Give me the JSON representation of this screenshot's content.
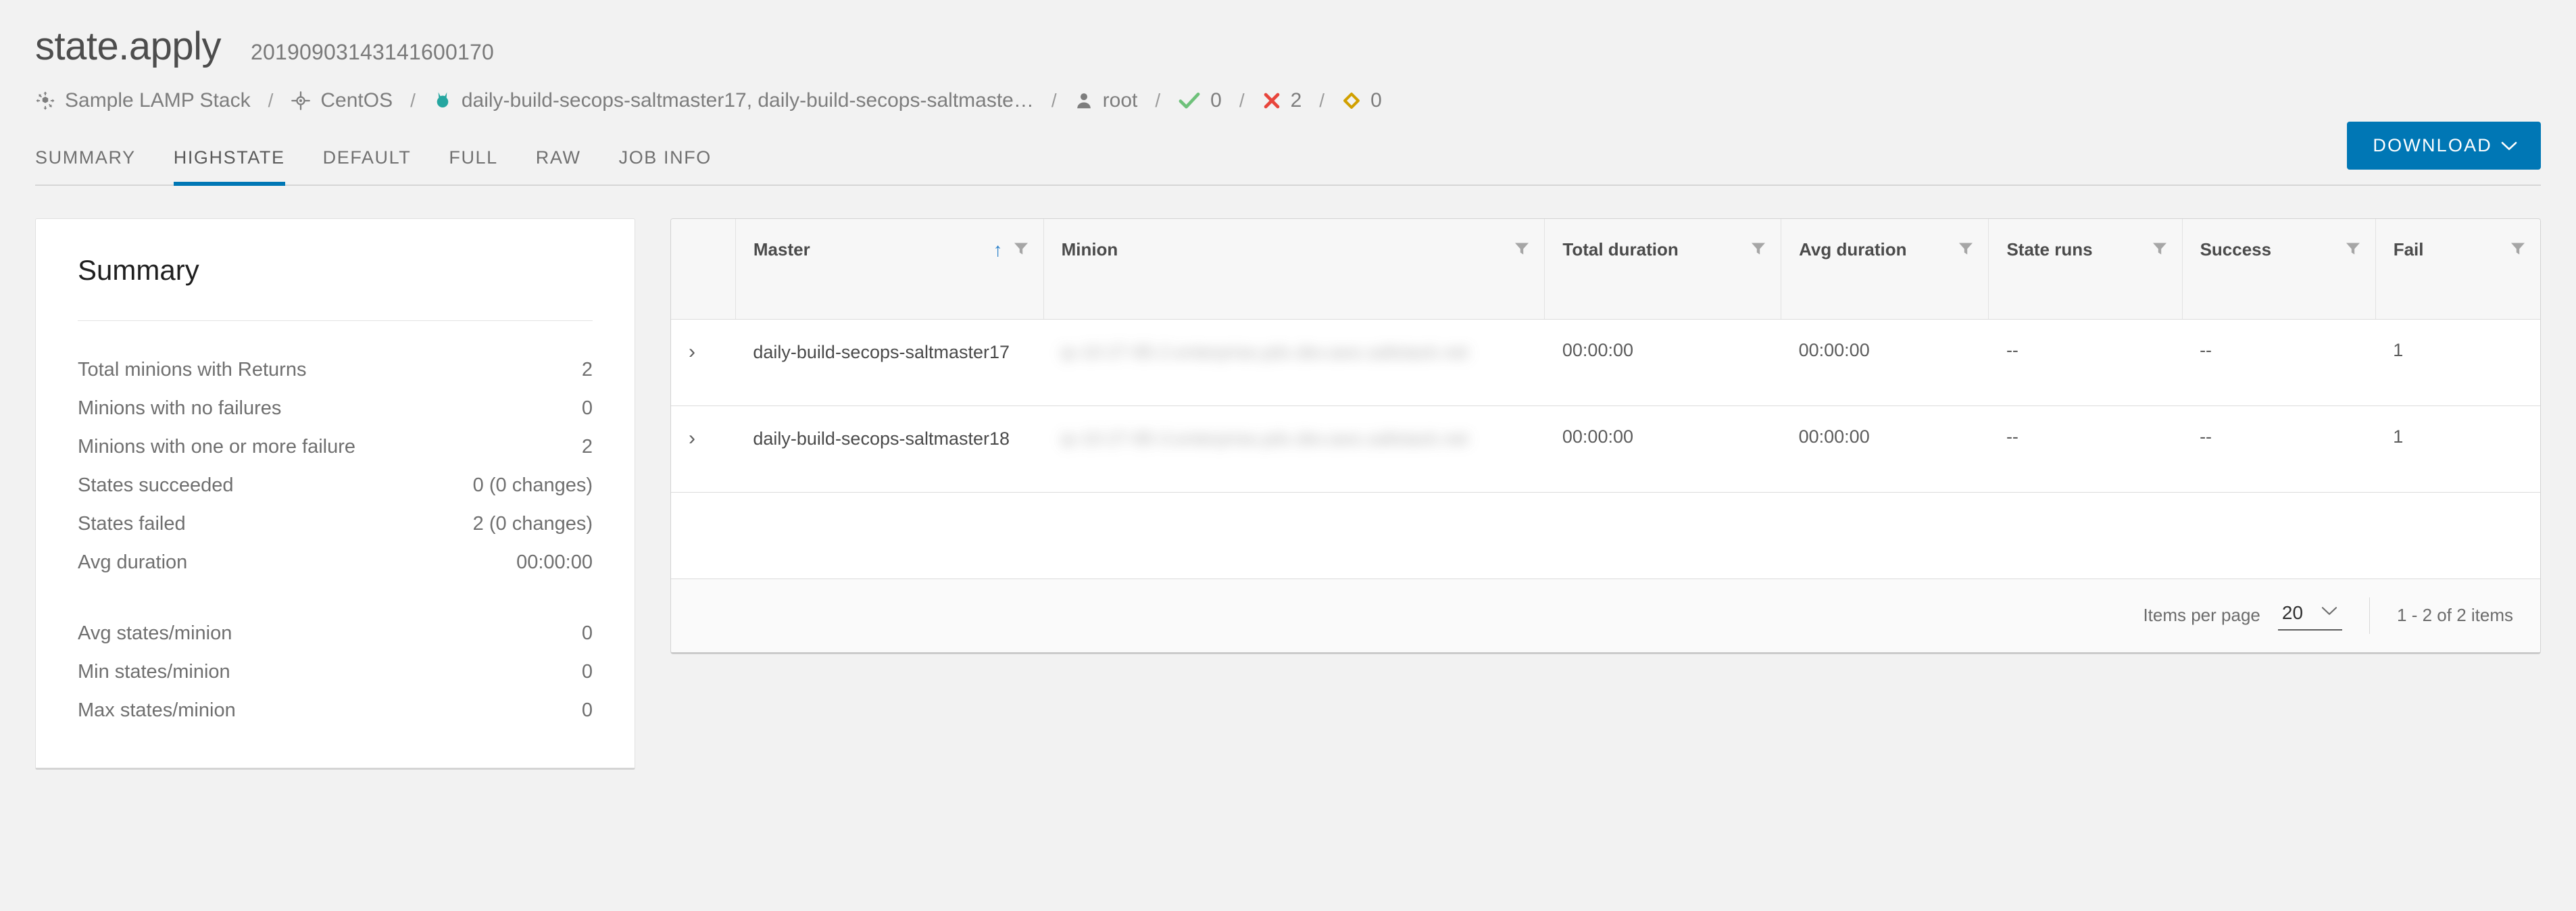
{
  "header": {
    "title": "state.apply",
    "job_id": "20190903143141600170"
  },
  "breadcrumb": {
    "items": [
      {
        "icon": "target-cluster-icon",
        "label": "Sample LAMP Stack"
      },
      {
        "icon": "crosshair-icon",
        "label": "CentOS"
      },
      {
        "icon": "salt-minion-icon",
        "label": "daily-build-secops-saltmaster17, daily-build-secops-saltmaste…"
      },
      {
        "icon": "user-icon",
        "label": "root"
      }
    ],
    "separator": "/",
    "stats": [
      {
        "icon": "check-icon",
        "value": "0",
        "color": "#6ec17a"
      },
      {
        "icon": "x-icon",
        "value": "2",
        "color": "#e8453c"
      },
      {
        "icon": "diamond-icon",
        "value": "0",
        "color": "#d1a000"
      }
    ]
  },
  "tabs": {
    "items": [
      {
        "label": "SUMMARY",
        "active": false
      },
      {
        "label": "HIGHSTATE",
        "active": true
      },
      {
        "label": "DEFAULT",
        "active": false
      },
      {
        "label": "FULL",
        "active": false
      },
      {
        "label": "RAW",
        "active": false
      },
      {
        "label": "JOB INFO",
        "active": false
      }
    ],
    "active_color": "#0077b5"
  },
  "toolbar": {
    "download_label": "DOWNLOAD",
    "download_caret": "⌄"
  },
  "summary": {
    "title": "Summary",
    "rows_group_1": [
      {
        "label": "Total minions with Returns",
        "value": "2"
      },
      {
        "label": "Minions with no failures",
        "value": "0"
      },
      {
        "label": "Minions with one or more failure",
        "value": "2"
      },
      {
        "label": "States succeeded",
        "value": "0 (0 changes)"
      },
      {
        "label": "States failed",
        "value": "2 (0 changes)"
      },
      {
        "label": "Avg duration",
        "value": "00:00:00"
      }
    ],
    "rows_group_2": [
      {
        "label": "Avg states/minion",
        "value": "0"
      },
      {
        "label": "Min states/minion",
        "value": "0"
      },
      {
        "label": "Max states/minion",
        "value": "0"
      }
    ]
  },
  "table": {
    "columns": [
      {
        "key": "expander",
        "label": "",
        "sorted": false,
        "filter": false
      },
      {
        "key": "master",
        "label": "Master",
        "sorted": true,
        "sort_dir": "↑",
        "filter": true
      },
      {
        "key": "minion",
        "label": "Minion",
        "sorted": false,
        "filter": true
      },
      {
        "key": "total_duration",
        "label": "Total duration",
        "sorted": false,
        "filter": true
      },
      {
        "key": "avg_duration",
        "label": "Avg duration",
        "sorted": false,
        "filter": true
      },
      {
        "key": "state_runs",
        "label": "State runs",
        "sorted": false,
        "filter": true
      },
      {
        "key": "success",
        "label": "Success",
        "sorted": false,
        "filter": true
      },
      {
        "key": "fail",
        "label": "Fail",
        "sorted": false,
        "filter": true
      }
    ],
    "rows": [
      {
        "expander": "›",
        "master": "daily-build-secops-saltmaster17",
        "minion": "ip-10-27-85-2.enterprise.pdx.dev.aws.saltstack.net",
        "total_duration": "00:00:00",
        "avg_duration": "00:00:00",
        "state_runs": "--",
        "success": "--",
        "fail": "1"
      },
      {
        "expander": "›",
        "master": "daily-build-secops-saltmaster18",
        "minion": "ip-10-27-85-3.enterprise.pdx.dev.aws.saltstack.net",
        "total_duration": "00:00:00",
        "avg_duration": "00:00:00",
        "state_runs": "--",
        "success": "--",
        "fail": "1"
      }
    ]
  },
  "pagination": {
    "items_per_page_label": "Items per page",
    "items_per_page_value": "20",
    "caret": "⌄",
    "range_text": "1 - 2 of 2 items"
  }
}
